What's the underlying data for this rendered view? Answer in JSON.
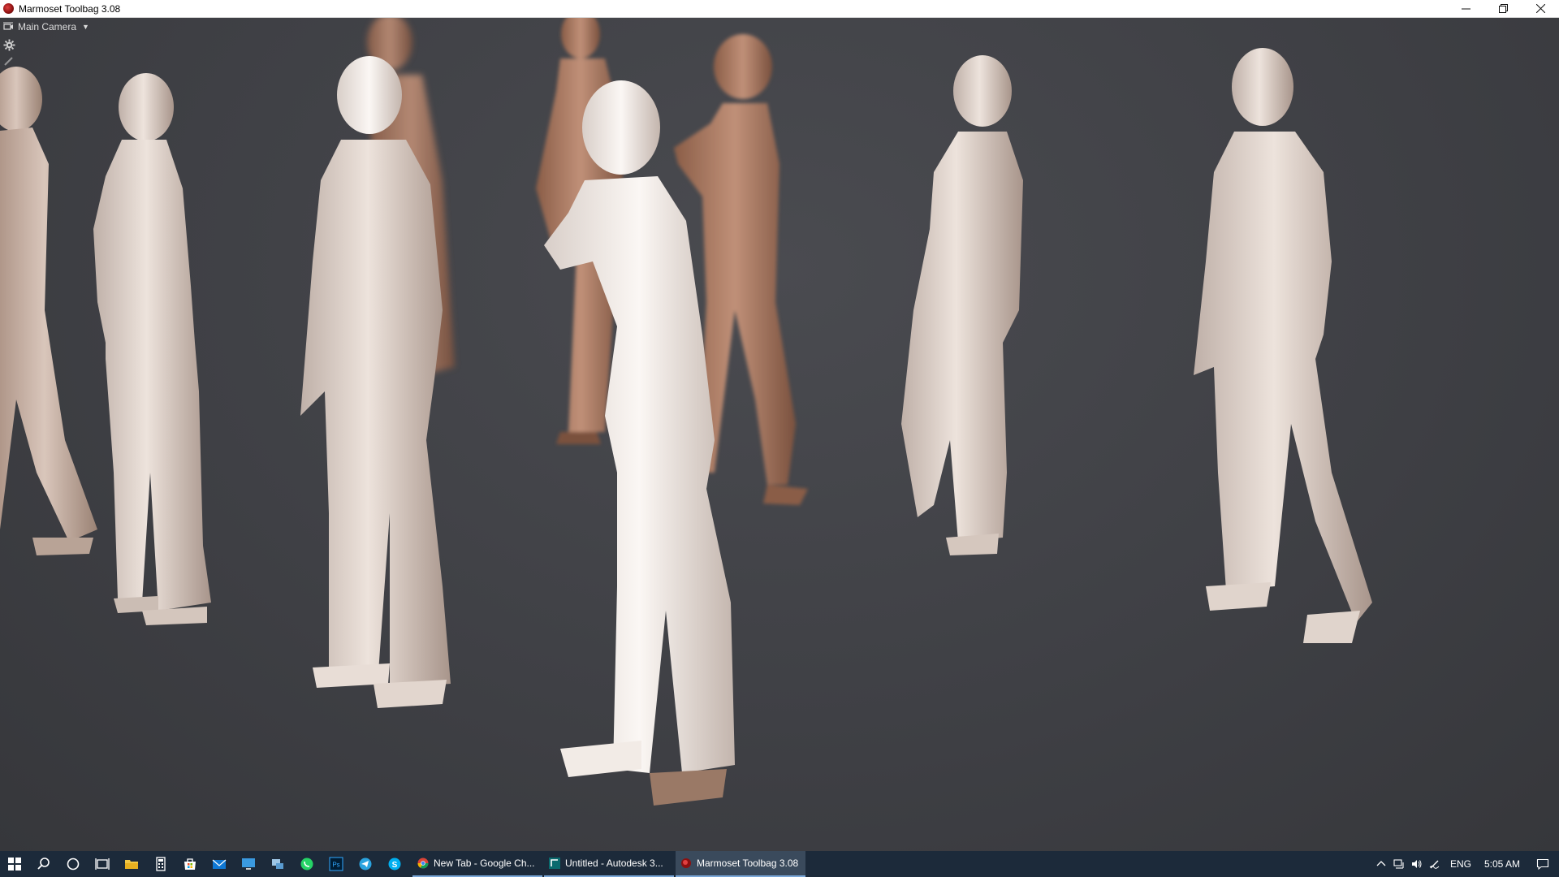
{
  "window": {
    "title": "Marmoset Toolbag 3.08",
    "controls": [
      "minimize",
      "restore",
      "close"
    ]
  },
  "viewport": {
    "camera_label": "Main Camera",
    "background_color": "#3f4045",
    "figure_light_color": "#e6d9d2",
    "figure_tan_color": "#b5826a"
  },
  "taskbar": {
    "pinned_icons": [
      "windows-start-icon",
      "search-icon",
      "cortana-icon",
      "task-view-icon",
      "file-explorer-icon",
      "calculator-icon",
      "store-icon",
      "mail-icon",
      "computer-icon",
      "network-icon",
      "whatsapp-icon",
      "photoshop-icon",
      "telegram-icon",
      "skype-icon"
    ],
    "apps": [
      {
        "label": "New Tab - Google Ch...",
        "icon": "chrome-icon",
        "active": false
      },
      {
        "label": "Untitled - Autodesk 3...",
        "icon": "3dsmax-icon",
        "active": false
      },
      {
        "label": "Marmoset Toolbag 3.08",
        "icon": "marmoset-icon",
        "active": true
      }
    ],
    "tray": {
      "language": "ENG",
      "time": "5:05 AM"
    }
  }
}
